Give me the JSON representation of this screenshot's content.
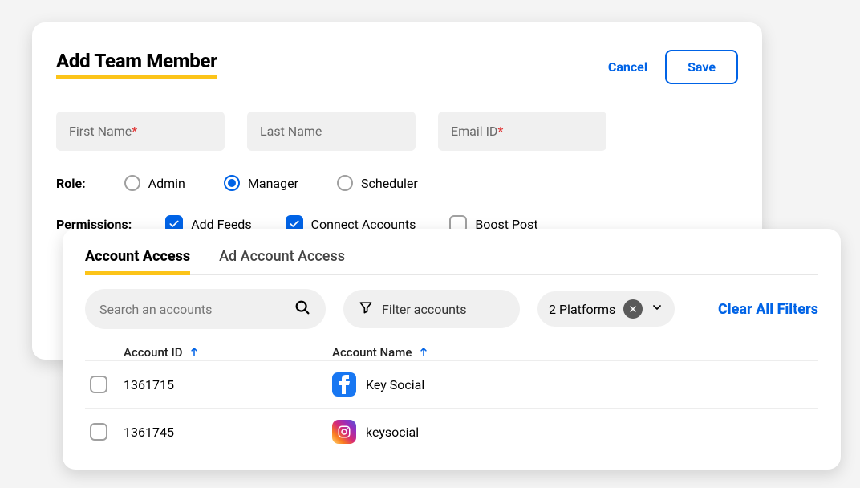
{
  "header": {
    "title": "Add Team Member",
    "cancel": "Cancel",
    "save": "Save"
  },
  "fields": {
    "first_name": {
      "placeholder": "First Name",
      "required": true,
      "value": ""
    },
    "last_name": {
      "placeholder": "Last Name",
      "required": false,
      "value": ""
    },
    "email_id": {
      "placeholder": "Email ID",
      "required": true,
      "value": ""
    }
  },
  "role": {
    "label": "Role:",
    "options": [
      "Admin",
      "Manager",
      "Scheduler"
    ],
    "selected": "Manager"
  },
  "permissions": {
    "label": "Permissions:",
    "items": [
      {
        "label": "Add Feeds",
        "checked": true
      },
      {
        "label": "Connect Accounts",
        "checked": true
      },
      {
        "label": "Boost Post",
        "checked": false
      }
    ]
  },
  "access": {
    "tabs": {
      "active": "Account Access",
      "items": [
        "Account Access",
        "Ad Account Access"
      ]
    },
    "search": {
      "placeholder": "Search an accounts",
      "value": ""
    },
    "filter": {
      "label": "Filter accounts"
    },
    "platforms": {
      "label": "2 Platforms"
    },
    "clear_all": "Clear All Filters",
    "columns": {
      "id": "Account ID",
      "name": "Account Name"
    },
    "rows": [
      {
        "id": "1361715",
        "name": "Key Social",
        "platform": "facebook",
        "checked": false
      },
      {
        "id": "1361745",
        "name": "keysocial",
        "platform": "instagram",
        "checked": false
      }
    ]
  }
}
